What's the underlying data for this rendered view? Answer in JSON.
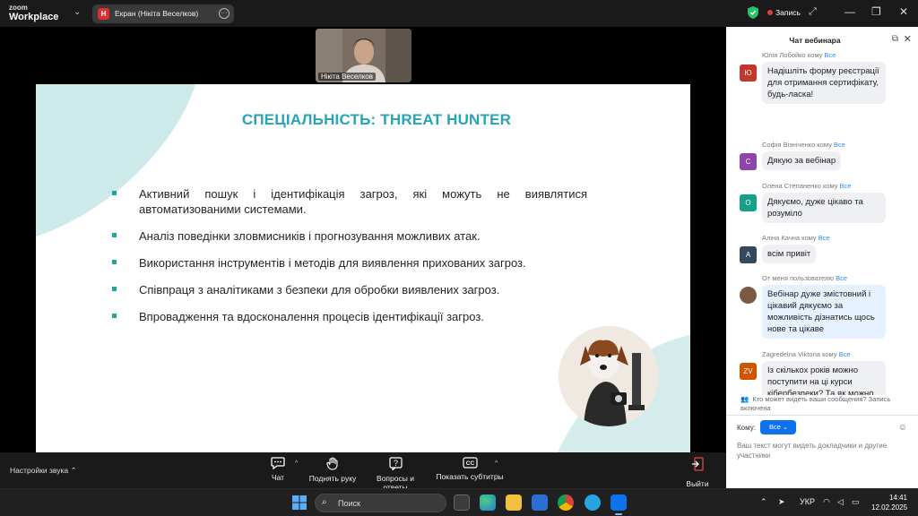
{
  "topbar": {
    "brand_small": "zoom",
    "brand_large": "Workplace",
    "share_badge": "Н",
    "share_label": "Екран (Нікіта Веселков)",
    "record_label": "Запись"
  },
  "participant": {
    "name": "Нікіта Веселков"
  },
  "slide": {
    "title": "СПЕЦІАЛЬНІСТЬ: THREAT HUNTER",
    "bullets": [
      "Активний пошук і ідентифікація загроз, які можуть не виявлятися автоматизованими системами.",
      "Аналіз поведінки зловмисників і прогнозування можливих атак.",
      "Використання інструментів і методів для виявлення прихованих загроз.",
      "Співпраця з аналітиками з безпеки для обробки виявлених загроз.",
      "Впровадження та вдосконалення процесів ідентифікації загроз."
    ]
  },
  "toolbar": {
    "audio_settings": "Настройки звука",
    "chat": "Чат",
    "raise_hand": "Поднять руку",
    "qa": "Вопросы и ответы",
    "captions": "Показать субтитры",
    "leave": "Выйти"
  },
  "chat": {
    "title": "Чат вебинара",
    "to_everyone": "Все",
    "messages": [
      {
        "sender": "Юлія Лобойко кому",
        "to": "Все",
        "initial": "Ю",
        "color": "#c0392b",
        "text": "Надішліть форму реєстрації для отримання сертифікату, будь-ласка!"
      },
      {
        "sender": "Софія Візніченко кому",
        "to": "Все",
        "initial": "С",
        "color": "#8e44ad",
        "text": "Дякую за вебінар"
      },
      {
        "sender": "Олена Степаненко кому",
        "to": "Все",
        "initial": "О",
        "color": "#16a085",
        "text": "Дякуємо, дуже цікаво та розумiло"
      },
      {
        "sender": "Аліна Качна кому",
        "to": "Все",
        "initial": "А",
        "color": "#34495e",
        "text": "всім привіт"
      },
      {
        "sender": "От меня пользователю",
        "to": "Все",
        "initial": "",
        "color": "#7a5a43",
        "text": "Вебінар дуже змістовний і цікавий дякуємо за можливість дізнатись щось нове та цікаве"
      },
      {
        "sender": "Zagredelna Viktoria кому",
        "to": "Все",
        "initial": "ZV",
        "color": "#d35400",
        "text": "Із скількох років можно поступити на ці курси кібербезпеки? Та як можно поступити?"
      }
    ],
    "notice": "Кто может видеть ваши сообщения? Запись включена",
    "to_label": "Кому:",
    "to_value": "Все",
    "input_hint": "Ваш текст могут видеть докладчики и другие участники"
  },
  "taskbar": {
    "search_placeholder": "Поиск",
    "language": "УКР",
    "time": "14:41",
    "date": "12.02.2025"
  },
  "colors": {
    "accent": "#29a3b6",
    "zoom_blue": "#0e72ed",
    "record_red": "#e23b3b"
  }
}
